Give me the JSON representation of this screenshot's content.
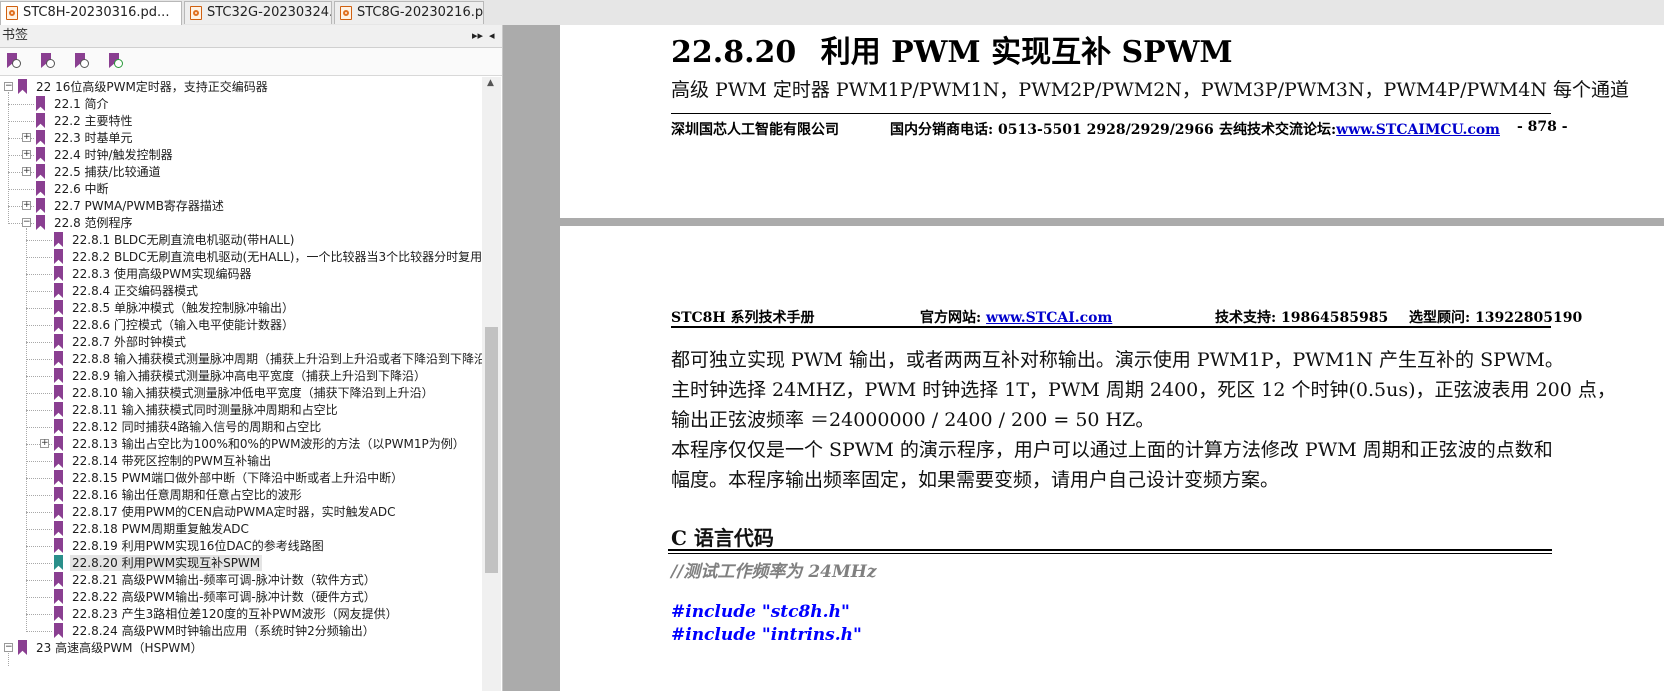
{
  "tabs": [
    {
      "label": "STC8H-20230316.pd..."
    },
    {
      "label": "STC32G-20230324..."
    },
    {
      "label": "STC8G-20230216.p..."
    }
  ],
  "panel": {
    "title": "书签",
    "controls": [
      "▸▸",
      "◂"
    ],
    "toolbar_icons": [
      "bookmark-options-icon",
      "bookmark-expand-icon",
      "bookmark-goto-icon",
      "bookmark-add-icon"
    ]
  },
  "bookmarks": [
    {
      "label": "22 16位高级PWM定时器，支持正交编码器",
      "level": 0,
      "toggle": "−"
    },
    {
      "label": "22.1 简介",
      "level": 1,
      "toggle": ""
    },
    {
      "label": "22.2 主要特性",
      "level": 1,
      "toggle": ""
    },
    {
      "label": "22.3 时基单元",
      "level": 1,
      "toggle": "+"
    },
    {
      "label": "22.4 时钟/触发控制器",
      "level": 1,
      "toggle": "+"
    },
    {
      "label": "22.5 捕获/比较通道",
      "level": 1,
      "toggle": "+"
    },
    {
      "label": "22.6 中断",
      "level": 1,
      "toggle": ""
    },
    {
      "label": "22.7 PWMA/PWMB寄存器描述",
      "level": 1,
      "toggle": "+"
    },
    {
      "label": "22.8 范例程序",
      "level": 1,
      "toggle": "−"
    },
    {
      "label": "22.8.1 BLDC无刷直流电机驱动(带HALL)",
      "level": 2,
      "toggle": ""
    },
    {
      "label": "22.8.2 BLDC无刷直流电机驱动(无HALL)，一个比较器当3个比较器分时复用",
      "level": 2,
      "toggle": ""
    },
    {
      "label": "22.8.3 使用高级PWM实现编码器",
      "level": 2,
      "toggle": ""
    },
    {
      "label": "22.8.4 正交编码器模式",
      "level": 2,
      "toggle": ""
    },
    {
      "label": "22.8.5 单脉冲模式（触发控制脉冲输出）",
      "level": 2,
      "toggle": ""
    },
    {
      "label": "22.8.6 门控模式（输入电平使能计数器）",
      "level": 2,
      "toggle": ""
    },
    {
      "label": "22.8.7 外部时钟模式",
      "level": 2,
      "toggle": ""
    },
    {
      "label": "22.8.8 输入捕获模式测量脉冲周期（捕获上升沿到上升沿或者下降沿到下降沿",
      "level": 2,
      "toggle": ""
    },
    {
      "label": "22.8.9 输入捕获模式测量脉冲高电平宽度（捕获上升沿到下降沿）",
      "level": 2,
      "toggle": ""
    },
    {
      "label": "22.8.10 输入捕获模式测量脉冲低电平宽度（捕获下降沿到上升沿）",
      "level": 2,
      "toggle": ""
    },
    {
      "label": "22.8.11 输入捕获模式同时测量脉冲周期和占空比",
      "level": 2,
      "toggle": ""
    },
    {
      "label": "22.8.12 同时捕获4路输入信号的周期和占空比",
      "level": 2,
      "toggle": ""
    },
    {
      "label": "22.8.13 输出占空比为100%和0%的PWM波形的方法（以PWM1P为例）",
      "level": 2,
      "toggle": "+"
    },
    {
      "label": "22.8.14 带死区控制的PWM互补输出",
      "level": 2,
      "toggle": ""
    },
    {
      "label": "22.8.15 PWM端口做外部中断（下降沿中断或者上升沿中断）",
      "level": 2,
      "toggle": ""
    },
    {
      "label": "22.8.16 输出任意周期和任意占空比的波形",
      "level": 2,
      "toggle": ""
    },
    {
      "label": "22.8.17 使用PWM的CEN启动PWMA定时器，实时触发ADC",
      "level": 2,
      "toggle": ""
    },
    {
      "label": "22.8.18 PWM周期重复触发ADC",
      "level": 2,
      "toggle": ""
    },
    {
      "label": "22.8.19 利用PWM实现16位DAC的参考线路图",
      "level": 2,
      "toggle": ""
    },
    {
      "label": "22.8.20 利用PWM实现互补SPWM",
      "level": 2,
      "toggle": "",
      "selected": true
    },
    {
      "label": "22.8.21 高级PWM输出-频率可调-脉冲计数（软件方式）",
      "level": 2,
      "toggle": ""
    },
    {
      "label": "22.8.22 高级PWM输出-频率可调-脉冲计数（硬件方式）",
      "level": 2,
      "toggle": ""
    },
    {
      "label": "22.8.23 产生3路相位差120度的互补PWM波形（网友提供）",
      "level": 2,
      "toggle": ""
    },
    {
      "label": "22.8.24 高级PWM时钟输出应用（系统时钟2分频输出）",
      "level": 2,
      "toggle": ""
    },
    {
      "label": "23 高速高级PWM（HSPWM）",
      "level": 0,
      "toggle": "−"
    }
  ],
  "page1": {
    "heading_number": "22.8.20",
    "heading_text": "利用 PWM 实现互补 SPWM",
    "intro": "高级 PWM 定时器 PWM1P/PWM1N，PWM2P/PWM2N，PWM3P/PWM3N，PWM4P/PWM4N 每个通道",
    "footer_company": "深圳国芯人工智能有限公司",
    "footer_phone": "国内分销商电话: 0513-5501 2928/2929/2966",
    "footer_forum_label": "去纯技术交流论坛:",
    "footer_forum_url": "www.STCAIMCU.com",
    "footer_page": "- 878 -"
  },
  "page2": {
    "header_manual": "STC8H 系列技术手册",
    "header_site_label": "官方网站: ",
    "header_site_url": "www.STCAI.com",
    "header_support": "技术支持: 19864585985",
    "header_consult": "选型顾问: 13922805190",
    "para_lines": [
      "都可独立实现 PWM 输出，或者两两互补对称输出。演示使用 PWM1P，PWM1N 产生互补的 SPWM。",
      "主时钟选择 24MHZ，PWM 时钟选择 1T，PWM 周期 2400，死区 12 个时钟(0.5us)，正弦波表用 200 点，",
      "输出正弦波频率 ＝24000000 / 2400 / 200 = 50 HZ。",
      "本程序仅仅是一个 SPWM 的演示程序，用户可以通过上面的计算方法修改 PWM 周期和正弦波的点数和",
      "幅度。本程序输出频率固定，如果需要变频，请用户自己设计变频方案。"
    ],
    "code_heading": "C 语言代码",
    "code_comment": "//测试工作频率为 24MHz",
    "code_lines": [
      "#include \"stc8h.h\"",
      "#include \"intrins.h\""
    ]
  },
  "colors": {
    "link": "#0000cc",
    "bookmark": "#8a3f91",
    "bookmark_selected": "#2a8f8a",
    "code_keyword": "#0000ff",
    "code_comment": "#808080"
  }
}
